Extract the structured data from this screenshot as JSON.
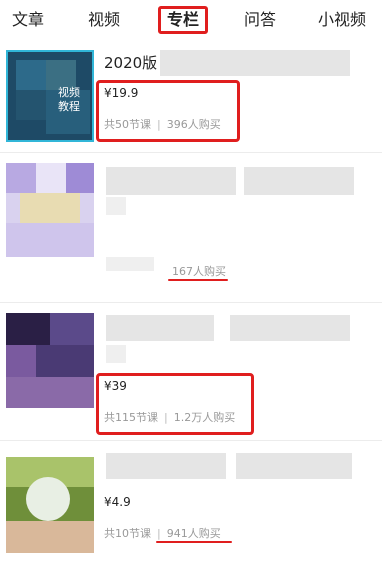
{
  "tabs": [
    {
      "label": "文章"
    },
    {
      "label": "视频"
    },
    {
      "label": "专栏"
    },
    {
      "label": "问答"
    },
    {
      "label": "小视频"
    }
  ],
  "active_tab": "专栏",
  "items": [
    {
      "title": "2020版",
      "thumb_text": "视频\n教程",
      "price": "¥19.9",
      "lessons": "共50节课",
      "buyers": "396人购买"
    },
    {
      "title": "",
      "price": "",
      "lessons": "",
      "buyers": "167人购买"
    },
    {
      "title": "",
      "price": "¥39",
      "lessons": "共115节课",
      "buyers": "1.2万人购买"
    },
    {
      "title": "",
      "price": "¥4.9",
      "lessons": "共10节课",
      "buyers": "941人购买"
    }
  ],
  "colors": {
    "highlight": "#e01e1e",
    "meta_text": "#999999"
  }
}
